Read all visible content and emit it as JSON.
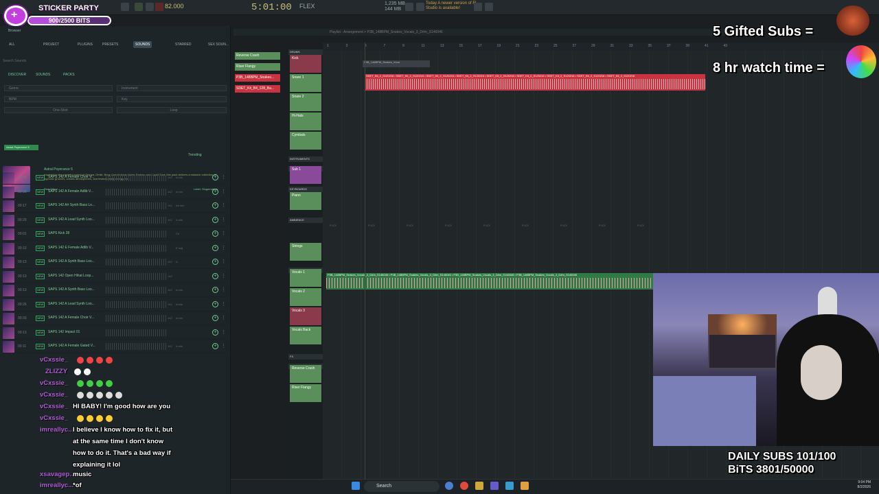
{
  "sticker": {
    "title": "STICKER PARTY",
    "bits": "900/2500 BITS",
    "progress_fraction": 0.36
  },
  "toolbar": {
    "tempo": "82.000",
    "time": "5:01:00",
    "snap": "FLEX",
    "cpu_top": "1,235 MB",
    "cpu_bottom": "144 MB",
    "news": "Today  A newer version of FL Studio is available!"
  },
  "browser": {
    "title": "Browser",
    "tabs": [
      "ALL",
      "PROJECT",
      "PLUGINS",
      "PRESETS",
      "SOUNDS",
      "STARRED",
      "SEX SOUN..."
    ],
    "active_tab": "SOUNDS",
    "search_placeholder": "Search Sounds",
    "subtabs": [
      "DISCOVER",
      "SOUNDS",
      "PACKS"
    ],
    "filters": [
      "Genre",
      "Instrument",
      "BPM",
      "Key",
      "One-Shot",
      "Loop"
    ],
    "pack_tag": "Astral Psyerance 5",
    "trending": "Trending",
    "pack": {
      "name": "Astral Psyerance 5",
      "description": "Inspired by the powerful sound of Omnya, Omiki, Berg, Ace Ventura, Astrix, Faders, and Liquid Soul, this pack delivers a massive collection of hypnotic grooves, cosmic atmospheres, and festival-ready energy for...",
      "read_more": "Read More",
      "label": "Label: Singomakers"
    },
    "samples": [
      {
        "dur": "00:33",
        "name": "SAPS 142 A Female Choir V...",
        "bpm": "142",
        "key": "A min"
      },
      {
        "dur": "00:16",
        "name": "SAPS 142 A Female Adlib V...",
        "bpm": "142",
        "key": "A min"
      },
      {
        "dur": "00:17",
        "name": "SAPS 142 A# Synth Bass Lo...",
        "bpm": "142",
        "key": "A# min"
      },
      {
        "dur": "00:20",
        "name": "SAPS 142 A Lead Synth Loo...",
        "bpm": "142",
        "key": "A min"
      },
      {
        "dur": "00:01",
        "name": "SAPS Kick 28",
        "bpm": "",
        "key": "C#"
      },
      {
        "dur": "00:10",
        "name": "SAPS 142 E Female Adlib V...",
        "bpm": "",
        "key": "E maj"
      },
      {
        "dur": "00:13",
        "name": "SAPS 142 A Synth Bass Loo...",
        "bpm": "142",
        "key": "A"
      },
      {
        "dur": "00:13",
        "name": "SAPS 142 Open Hihat Loop...",
        "bpm": "142",
        "key": ""
      },
      {
        "dur": "00:13",
        "name": "SAPS 142 A Synth Bass Loo...",
        "bpm": "142",
        "key": "A min"
      },
      {
        "dur": "00:26",
        "name": "SAPS 142 A Lead Synth Loo...",
        "bpm": "142",
        "key": "A min"
      },
      {
        "dur": "00:33",
        "name": "SAPS 142 A Female Choir V...",
        "bpm": "142",
        "key": "A min"
      },
      {
        "dur": "00:13",
        "name": "SAPS 142 Impact 01",
        "bpm": "",
        "key": ""
      },
      {
        "dur": "00:11",
        "name": "SAPS 142 A Female Gated V...",
        "bpm": "142",
        "key": "A min"
      }
    ]
  },
  "chat": [
    {
      "user": "vCxssie_",
      "msg": ""
    },
    {
      "user": "ZLIZZY",
      "msg": ""
    },
    {
      "user": "vCxssie_",
      "msg": ""
    },
    {
      "user": "vCxssie_",
      "msg": ""
    },
    {
      "user": "vCxssie_",
      "msg": "HI BABY! I'm good how are you"
    },
    {
      "user": "vCxssie_",
      "msg": ""
    },
    {
      "user": "imreallyc...",
      "msg": "I believe I know how to fix it, but"
    },
    {
      "user": "",
      "msg": "at the same time I don't know"
    },
    {
      "user": "",
      "msg": "how to do it. That's a bad way if"
    },
    {
      "user": "",
      "msg": "explaining it lol"
    },
    {
      "user": "xsavagep...",
      "msg": "music"
    },
    {
      "user": "imreallyc...",
      "msg": "*of"
    }
  ],
  "rack": {
    "patterns": [
      "Reverse Crash",
      "Riser Flangy",
      "P3B_148BPM_Snakes...",
      "SDET_Kit_B4_128_Ba..."
    ]
  },
  "playlist": {
    "header": "Playlist - Arrangement  >  P3B_148BPM_Snakes_Vocals_3_D#m_S146046",
    "tracks": [
      "Kick",
      "Snare 1",
      "Snare 2",
      "Hi-Hats",
      "Cymbals",
      "Sub 1",
      "Piano",
      "Strings",
      "Vocals 1",
      "Vocals 2",
      "Vocals 3",
      "Vocals Back",
      "Reverse Crash",
      "Riser Flangy"
    ],
    "groups": [
      "DRUMS",
      "INSTRUMENTS",
      "SUBS",
      "KEYBOARDS",
      "AMBIENCE",
      "VOCALS",
      "FX",
      "RISERS"
    ],
    "clip_drum_label": "P3B_148BPM_Snakes_Voca",
    "clip_red": "SDET_Kit_2_S120216 • SDET_Kit_2_S120216 • SDET_Kit_2_S120216 • SDET_Kit_2_S120216 • SDET_Kit_2_S120216 • SDET_Kit_2_S120216 • SDET_Kit_2_S120216 • SDET_Kit_2_S120216 • SDET_Kit_2_S120216",
    "clip_green": "P3B_148BPM_Snakes_Vocals_3_D#m_S146046 • P3B_148BPM_Snakes_Vocals_3_D#m_S146046 • P3B_148BPM_Snakes_Vocals_3_D#m_S146046 • P3B_148BPM_Snakes_Vocals_3_D#m_S146046",
    "flex_marker": "FLEX",
    "timeline_numbers": [
      "1",
      "3",
      "5",
      "7",
      "9",
      "11",
      "13",
      "15",
      "17",
      "19",
      "21",
      "23",
      "25",
      "27",
      "29",
      "31",
      "33",
      "35",
      "37",
      "39",
      "41",
      "43"
    ]
  },
  "overlays": {
    "gifted": "5 Gifted Subs =",
    "watch": "8 hr watch time =",
    "daily_subs": "DAILY SUBS 101/100",
    "bits": "BiTS 3801/50000"
  },
  "taskbar": {
    "search": "Search",
    "time": "9:04 PM",
    "date": "8/2/2026"
  },
  "colors": {
    "clip_red": "#c8343f",
    "clip_green": "#2f7a45",
    "track_green": "#5a8f5c",
    "purple": "#b35ad8"
  }
}
